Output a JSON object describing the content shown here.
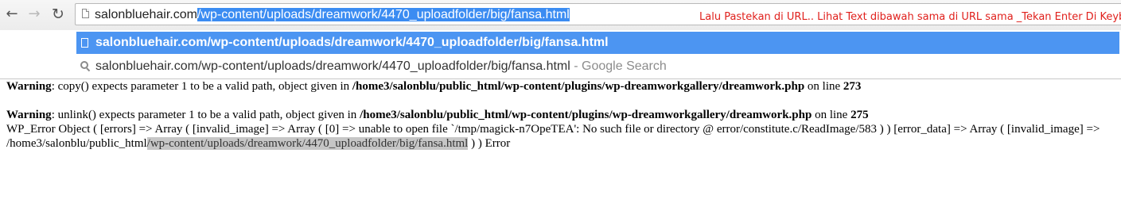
{
  "toolbar": {
    "back_icon": "back-arrow-icon",
    "forward_icon": "forward-arrow-icon",
    "reload_icon": "reload-icon"
  },
  "omnibox": {
    "domain": "salonbluehair.com",
    "path_selected": "/wp-content/uploads/dreamwork/4470_uploadfolder/big/fansa.html",
    "annotation": "Lalu Pastekan di URL.. Lihat Text dibawah sama di URL sama _Tekan Enter Di Keyboard",
    "selection_color": "#3b8cf2",
    "annotation_color": "#e0201c"
  },
  "suggestions": [
    {
      "icon": "page-icon",
      "text": "salonbluehair.com/wp-content/uploads/dreamwork/4470_uploadfolder/big/fansa.html"
    },
    {
      "icon": "search-icon",
      "text": "salonbluehair.com/wp-content/uploads/dreamwork/4470_uploadfolder/big/fansa.html",
      "suffix": " - Google Search"
    }
  ],
  "page": {
    "warning1": {
      "label": "Warning",
      "message": ": copy() expects parameter 1 to be a valid path, object given in ",
      "file": "/home3/salonblu/public_html/wp-content/plugins/wp-dreamworkgallery/dreamwork.php",
      "on_line": " on line ",
      "line": "273"
    },
    "warning2": {
      "label": "Warning",
      "message": ": unlink() expects parameter 1 to be a valid path, object given in ",
      "file": "/home3/salonblu/public_html/wp-content/plugins/wp-dreamworkgallery/dreamwork.php",
      "on_line": " on line ",
      "line": "275"
    },
    "error_object": {
      "text": "WP_Error Object ( [errors] => Array ( [invalid_image] => Array ( [0] => unable to open file `/tmp/magick-n7OpeTEA': No such file or directory @ error/constitute.c/ReadImage/583 ) ) [error_data] => Array ( [invalid_image] => /home3/salonblu/public_html",
      "highlighted": "/wp-content/uploads/dreamwork/4470_uploadfolder/big/fansa.html",
      "tail": " ) ) Error"
    }
  }
}
